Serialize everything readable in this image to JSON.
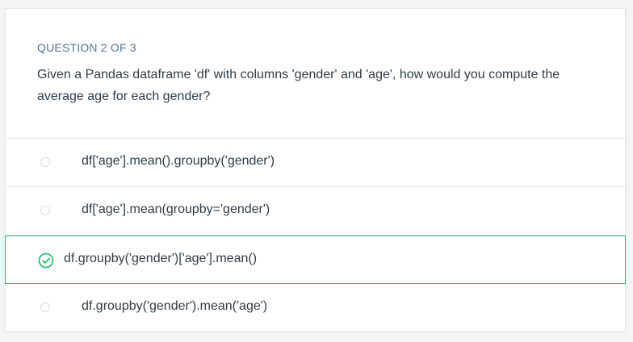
{
  "question": {
    "counter": "QUESTION 2 OF 3",
    "text": "Given a Pandas dataframe 'df' with columns 'gender' and 'age', how would you compute the average age for each gender?"
  },
  "options": [
    {
      "label": "df['age'].mean().groupby('gender')",
      "selected": false
    },
    {
      "label": "df['age'].mean(groupby='gender')",
      "selected": false
    },
    {
      "label": "df.groupby('gender')['age'].mean()",
      "selected": true
    },
    {
      "label": "df.groupby('gender').mean('age')",
      "selected": false
    }
  ],
  "colors": {
    "accent": "#2fbf71",
    "header_text": "#52739a",
    "body_text": "#2e3d49",
    "border": "#e3e6ea"
  },
  "icons": {
    "selected": "check-circle-icon",
    "unselected": "radio-empty-icon"
  }
}
